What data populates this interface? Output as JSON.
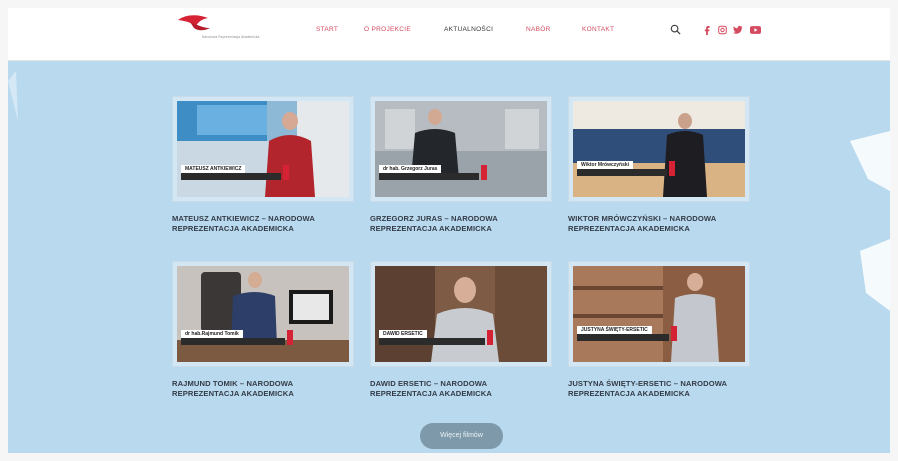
{
  "header": {
    "logo_text": "Narodowa Reprezentacja Akademicka",
    "nav": [
      {
        "label": "START",
        "active": false
      },
      {
        "label": "O PROJEKCIE",
        "active": false
      },
      {
        "label": "AKTUALNOŚCI",
        "active": true
      },
      {
        "label": "NABÓR",
        "active": false
      },
      {
        "label": "KONTAKT",
        "active": false
      }
    ],
    "icons": [
      "search-icon",
      "facebook-icon",
      "instagram-icon",
      "twitter-icon",
      "youtube-icon"
    ]
  },
  "videos": [
    {
      "title": "MATEUSZ ANTKIEWICZ – NARODOWA REPREZENTACJA AKADEMICKA",
      "name_tag": "MATEUSZ ANTKIEWICZ"
    },
    {
      "title": "GRZEGORZ JURAS – NARODOWA REPREZENTACJA AKADEMICKA",
      "name_tag": "dr hab. Grzegorz Juras"
    },
    {
      "title": "WIKTOR MRÓWCZYŃSKI – NARODOWA REPREZENTACJA AKADEMICKA",
      "name_tag": "Wiktor Mrówczyński"
    },
    {
      "title": "RAJMUND TOMIK – NARODOWA REPREZENTACJA AKADEMICKA",
      "name_tag": "dr hab.Rajmund Tomik"
    },
    {
      "title": "DAWID ERSETIC – NARODOWA REPREZENTACJA AKADEMICKA",
      "name_tag": "DAWID ERSETIC"
    },
    {
      "title": "JUSTYNA ŚWIĘTY-ERSETIC – NARODOWA REPREZENTACJA AKADEMICKA",
      "name_tag": "JUSTYNA ŚWIĘTY-ERSETIC"
    }
  ],
  "more_button": "Więcej filmów",
  "colors": {
    "accent": "#d52335",
    "background": "#b9d9ee",
    "button": "#7e9aaa"
  }
}
